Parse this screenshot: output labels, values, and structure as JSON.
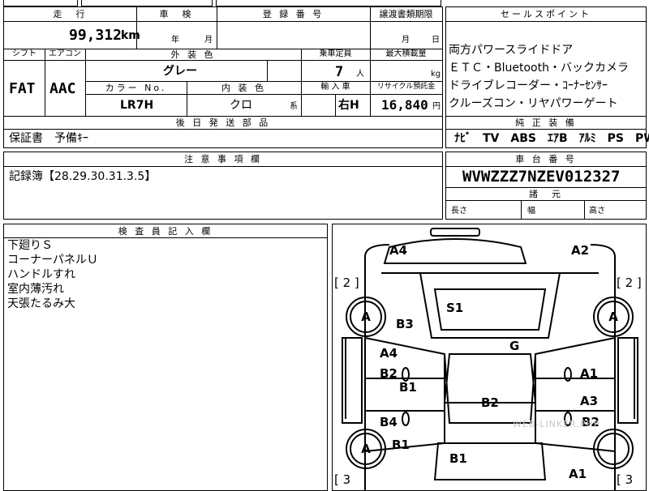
{
  "top": {
    "mileage_header": "走　行",
    "mileage_value": "99,312",
    "mileage_unit": "km",
    "shaken_header": "車　検",
    "shaken_year_unit": "年",
    "shaken_month_unit": "月",
    "reg_number_header": "登 録 番 号",
    "transfer_deadline_header": "譲渡書類期限",
    "transfer_month_unit": "月",
    "transfer_day_unit": "日",
    "shift_header": "シフト",
    "shift_value": "FAT",
    "aircon_header": "エアコン",
    "aircon_value": "AAC",
    "exterior_color_header": "外 装 色",
    "exterior_color_value": "グレー",
    "capacity_header": "乗車定員",
    "capacity_value": "7",
    "capacity_unit": "人",
    "max_load_header": "最大積載量",
    "max_load_unit": "kg",
    "color_no_header": "カラー No.",
    "color_no_value": "LR7H",
    "interior_color_header": "内 装 色",
    "interior_color_value": "クロ",
    "interior_color_suffix": "系",
    "import_header": "輸 入 車",
    "import_value": "右H",
    "recycle_header": "リサイクル預託金",
    "recycle_value": "16,840",
    "recycle_unit": "円",
    "later_parts_header": "後 日 発 送 部 品",
    "later_parts_value": "保証書　予備ｷｰ"
  },
  "sales_points": {
    "header": "セールスポイント",
    "lines": [
      "両方パワースライドドア",
      "ＥＴＣ・Bluetooth・バックカメラ",
      "ドライブレコーダー・ｺｰﾅｰｾﾝｻｰ",
      "クルーズコン・リヤパワーゲート"
    ]
  },
  "equipment": {
    "header": "純 正 装 備",
    "value": "ﾅﾋﾞ　TV　ABS　ｴｱB　ｱﾙﾐ　PS　PW"
  },
  "notes": {
    "header": "注 意 事 項 欄",
    "value": "記録簿【28.29.30.31.3.5】"
  },
  "chassis": {
    "header": "車 台 番 号",
    "value": "WVWZZZ7NZEV012327",
    "dimensions_header": "諸　元",
    "length_label": "長さ",
    "width_label": "幅",
    "height_label": "高さ"
  },
  "inspector": {
    "header": "検 査 員 記 入 欄",
    "lines": [
      "下廻りＳ",
      "コーナーパネルＵ",
      "ハンドルすれ",
      "室内薄汚れ",
      "天張たるみ大"
    ]
  },
  "diagram": {
    "marks": {
      "a4_top": "A4",
      "a2_top": "A2",
      "bracket_left_top": "[ 2 ]",
      "bracket_right_top": "[ 2 ]",
      "wheel_fl": "A",
      "wheel_fr": "A",
      "wheel_rl": "A",
      "b3": "B3",
      "s1": "S1",
      "g": "G",
      "a4_left": "A4",
      "b2_left": "B2",
      "b1_left": "B1",
      "a1_right": "A1",
      "b2_center": "B2",
      "a3_right": "A3",
      "b4_left": "B4",
      "b2_right": "B2",
      "b1_wheel": "B1",
      "b1_bottom": "B1",
      "a1_bottom": "A1",
      "bracket_left_bottom": "[ 3",
      "bracket_right_bottom": "[ 3"
    },
    "watermark": "WEB-LINKER.PHP"
  }
}
